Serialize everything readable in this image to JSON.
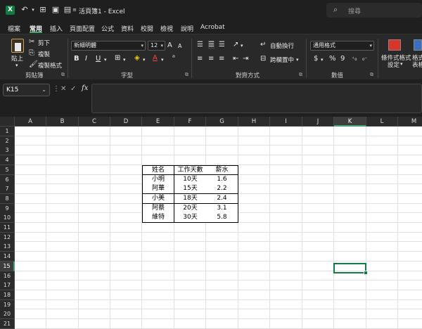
{
  "titlebar": {
    "title": "活頁簿1 - Excel",
    "search_placeholder": "搜尋"
  },
  "tabs": [
    {
      "label": "檔案",
      "active": false
    },
    {
      "label": "常用",
      "active": true
    },
    {
      "label": "插入",
      "active": false
    },
    {
      "label": "頁面配置",
      "active": false
    },
    {
      "label": "公式",
      "active": false
    },
    {
      "label": "資料",
      "active": false
    },
    {
      "label": "校閱",
      "active": false
    },
    {
      "label": "檢視",
      "active": false
    },
    {
      "label": "說明",
      "active": false
    },
    {
      "label": "Acrobat",
      "active": false
    }
  ],
  "ribbon": {
    "clipboard": {
      "group_label": "剪貼簿",
      "paste_label": "貼上",
      "cut_label": "剪下",
      "copy_label": "複製",
      "format_painter_label": "複製格式"
    },
    "font": {
      "group_label": "字型",
      "font_name": "新細明體",
      "font_size": "12"
    },
    "alignment": {
      "group_label": "對齊方式",
      "wrap_text_label": "自動換行",
      "merge_center_label": "跨欄置中"
    },
    "number": {
      "group_label": "數值",
      "format": "通用格式",
      "currency_symbol": "$",
      "percent_symbol": "%",
      "comma_symbol": "9"
    },
    "styles": {
      "conditional_label": "條件式格式",
      "conditional_label2": "設定",
      "table_label": "格式",
      "table_label2": "表格"
    }
  },
  "formula_bar": {
    "name_box": "K15",
    "fx_label": "fx",
    "content": ""
  },
  "sheet": {
    "columns": [
      "A",
      "B",
      "C",
      "D",
      "E",
      "F",
      "G",
      "H",
      "I",
      "J",
      "K",
      "L",
      "M"
    ],
    "selected_column": "K",
    "rows": [
      "1",
      "2",
      "3",
      "4",
      "5",
      "6",
      "7",
      "8",
      "9",
      "10",
      "11",
      "12",
      "13",
      "14",
      "15",
      "16",
      "17",
      "18",
      "19",
      "20",
      "21"
    ],
    "selected_row": "15",
    "active_cell": "K15",
    "table": {
      "headers": [
        "姓名",
        "工作天數",
        "薪水"
      ],
      "rows": [
        [
          "小明",
          "10天",
          "1.6"
        ],
        [
          "阿華",
          "15天",
          "2.2"
        ],
        [
          "小美",
          "18天",
          "2.4"
        ],
        [
          "阿蔡",
          "20天",
          "3.1"
        ],
        [
          "維特",
          "30天",
          "5.8"
        ]
      ]
    }
  }
}
